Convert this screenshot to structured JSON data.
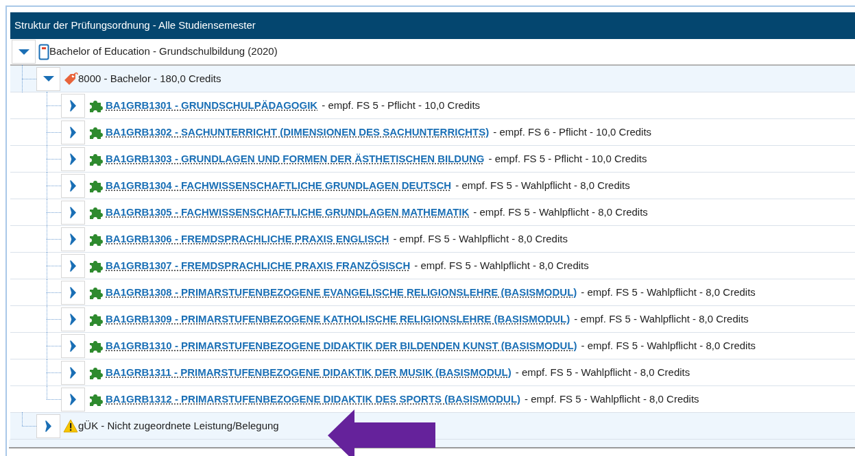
{
  "header": {
    "title": "Struktur der Prüfungsordnung - Alle Studiensemester"
  },
  "tree": [
    {
      "kind": "program",
      "label": "Bachelor of Education - Grundschulbildung (2020)",
      "expanded": true,
      "children": [
        {
          "kind": "node",
          "label": "8000 - Bachelor - 180,0 Credits",
          "expanded": true,
          "children": [
            {
              "kind": "module",
              "link": "BA1GRB1301 - GRUNDSCHULPÄDAGOGIK",
              "detail": "- empf. FS 5 - Pflicht - 10,0 Credits",
              "expanded": false
            },
            {
              "kind": "module",
              "link": "BA1GRB1302 - SACHUNTERRICHT (DIMENSIONEN DES SACHUNTERRICHTS)",
              "detail": "- empf. FS 6 - Pflicht - 10,0 Credits",
              "expanded": false
            },
            {
              "kind": "module",
              "link": "BA1GRB1303 - GRUNDLAGEN UND FORMEN DER ÄSTHETISCHEN BILDUNG",
              "detail": "- empf. FS 5 - Pflicht - 10,0 Credits",
              "expanded": false
            },
            {
              "kind": "module",
              "link": "BA1GRB1304 - FACHWISSENSCHAFTLICHE GRUNDLAGEN DEUTSCH",
              "detail": "- empf. FS 5 - Wahlpflicht - 8,0 Credits",
              "expanded": false
            },
            {
              "kind": "module",
              "link": "BA1GRB1305 - FACHWISSENSCHAFTLICHE GRUNDLAGEN MATHEMATIK",
              "detail": "- empf. FS 5 - Wahlpflicht - 8,0 Credits",
              "expanded": false
            },
            {
              "kind": "module",
              "link": "BA1GRB1306 - FREMDSPRACHLICHE PRAXIS ENGLISCH",
              "detail": "- empf. FS 5 - Wahlpflicht - 8,0 Credits",
              "expanded": false
            },
            {
              "kind": "module",
              "link": "BA1GRB1307 - FREMDSPRACHLICHE PRAXIS FRANZÖSISCH",
              "detail": "- empf. FS 5 - Wahlpflicht - 8,0 Credits",
              "expanded": false
            },
            {
              "kind": "module",
              "link": "BA1GRB1308 - PRIMARSTUFENBEZOGENE EVANGELISCHE RELIGIONSLEHRE (BASISMODUL)",
              "detail": "- empf. FS 5 - Wahlpflicht - 8,0 Credits",
              "expanded": false
            },
            {
              "kind": "module",
              "link": "BA1GRB1309 - PRIMARSTUFENBEZOGENE KATHOLISCHE RELIGIONSLEHRE (BASISMODUL)",
              "detail": "- empf. FS 5 - Wahlpflicht - 8,0 Credits",
              "expanded": false
            },
            {
              "kind": "module",
              "link": "BA1GRB1310 - PRIMARSTUFENBEZOGENE DIDAKTIK DER BILDENDEN KUNST (BASISMODUL)",
              "detail": "- empf. FS 5 - Wahlpflicht - 8,0 Credits",
              "expanded": false
            },
            {
              "kind": "module",
              "link": "BA1GRB1311 - PRIMARSTUFENBEZOGENE DIDAKTIK DER MUSIK (BASISMODUL)",
              "detail": "- empf. FS 5 - Wahlpflicht - 8,0 Credits",
              "expanded": false
            },
            {
              "kind": "module",
              "link": "BA1GRB1312 - PRIMARSTUFENBEZOGENE DIDAKTIK DES SPORTS (BASISMODUL)",
              "detail": "- empf. FS 5 - Wahlpflicht - 8,0 Credits",
              "expanded": false
            }
          ]
        },
        {
          "kind": "warning",
          "label": "gÜK - Nicht zugeordnete Leistung/Belegung",
          "expanded": false
        }
      ]
    }
  ]
}
